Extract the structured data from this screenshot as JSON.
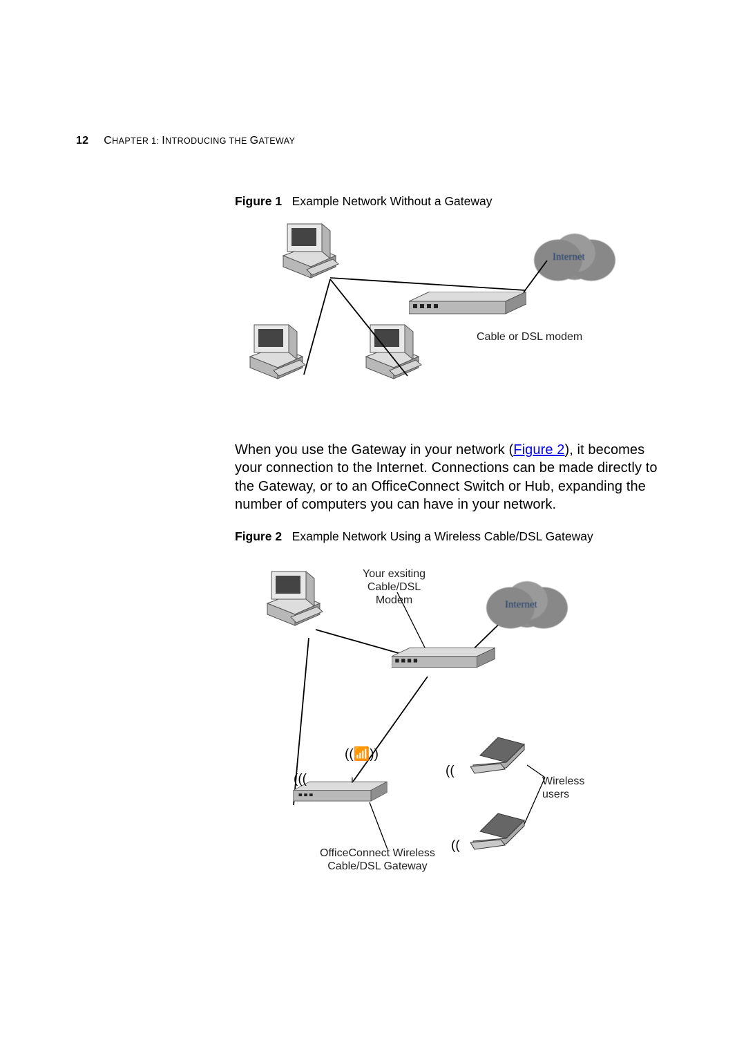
{
  "header": {
    "page_number": "12",
    "chapter_label_parts": {
      "C": "C",
      "hapter": "HAPTER",
      "sep": " 1: ",
      "I": "I",
      "ntroducing": "NTRODUCING",
      "the": " THE ",
      "G": "G",
      "ateway": "ATEWAY"
    }
  },
  "figure1": {
    "label": "Figure 1",
    "caption": "Example Network Without a Gateway",
    "cloud_label": "Internet",
    "modem_label": "Cable or DSL modem"
  },
  "body_paragraph": {
    "pre_link": "When you use the Gateway in your network (",
    "link_text": "Figure 2",
    "post_link": "), it becomes your connection to the Internet. Connections can be made directly to the Gateway, or to an OfficeConnect Switch or Hub, expanding the number of computers you can have in your network."
  },
  "figure2": {
    "label": "Figure 2",
    "caption": "Example Network Using a Wireless Cable/DSL Gateway",
    "existing_modem_label": "Your exsiting\nCable/DSL\nModem",
    "cloud_label": "Internet",
    "router_label": "OfficeConnect Wireless\nCable/DSL Gateway",
    "wifi_users_label": "Wireless\nusers"
  }
}
